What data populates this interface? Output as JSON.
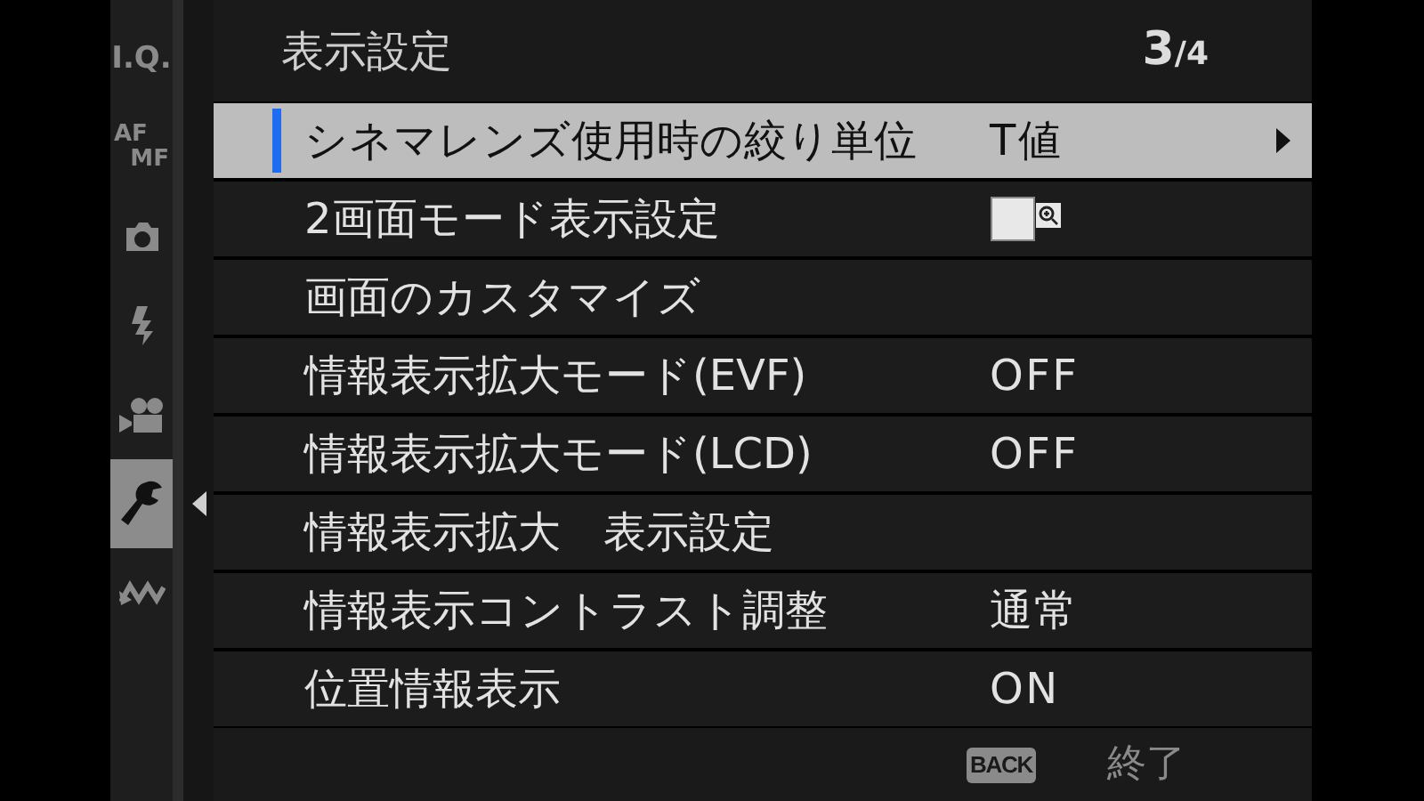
{
  "sidebar": {
    "tabs": [
      {
        "kind": "text",
        "lines": [
          "I.Q."
        ],
        "selected": false
      },
      {
        "kind": "text",
        "lines": [
          "AF",
          "MF"
        ],
        "selected": false
      },
      {
        "kind": "camera",
        "selected": false
      },
      {
        "kind": "flash",
        "selected": false
      },
      {
        "kind": "movie",
        "selected": false
      },
      {
        "kind": "wrench",
        "selected": true
      },
      {
        "kind": "connection",
        "selected": false
      }
    ]
  },
  "header": {
    "title": "表示設定",
    "page": "3",
    "page_total": "/4"
  },
  "rows": [
    {
      "label": "シネマレンズ使用時の絞り単位",
      "kind": "text",
      "value": "T値",
      "selected": true
    },
    {
      "label": "2画面モード表示設定",
      "kind": "icon",
      "selected": false
    },
    {
      "label": "画面のカスタマイズ",
      "kind": "none",
      "selected": false
    },
    {
      "label": "情報表示拡大モード(EVF)",
      "kind": "text",
      "value": "OFF",
      "selected": false
    },
    {
      "label": "情報表示拡大モード(LCD)",
      "kind": "text",
      "value": "OFF",
      "selected": false
    },
    {
      "label": "情報表示拡大　表示設定",
      "kind": "none",
      "selected": false
    },
    {
      "label": "情報表示コントラスト調整",
      "kind": "text",
      "value": "通常",
      "selected": false
    },
    {
      "label": "位置情報表示",
      "kind": "text",
      "value": "ON",
      "selected": false
    }
  ],
  "footer": {
    "key": "BACK",
    "action": "終了"
  }
}
